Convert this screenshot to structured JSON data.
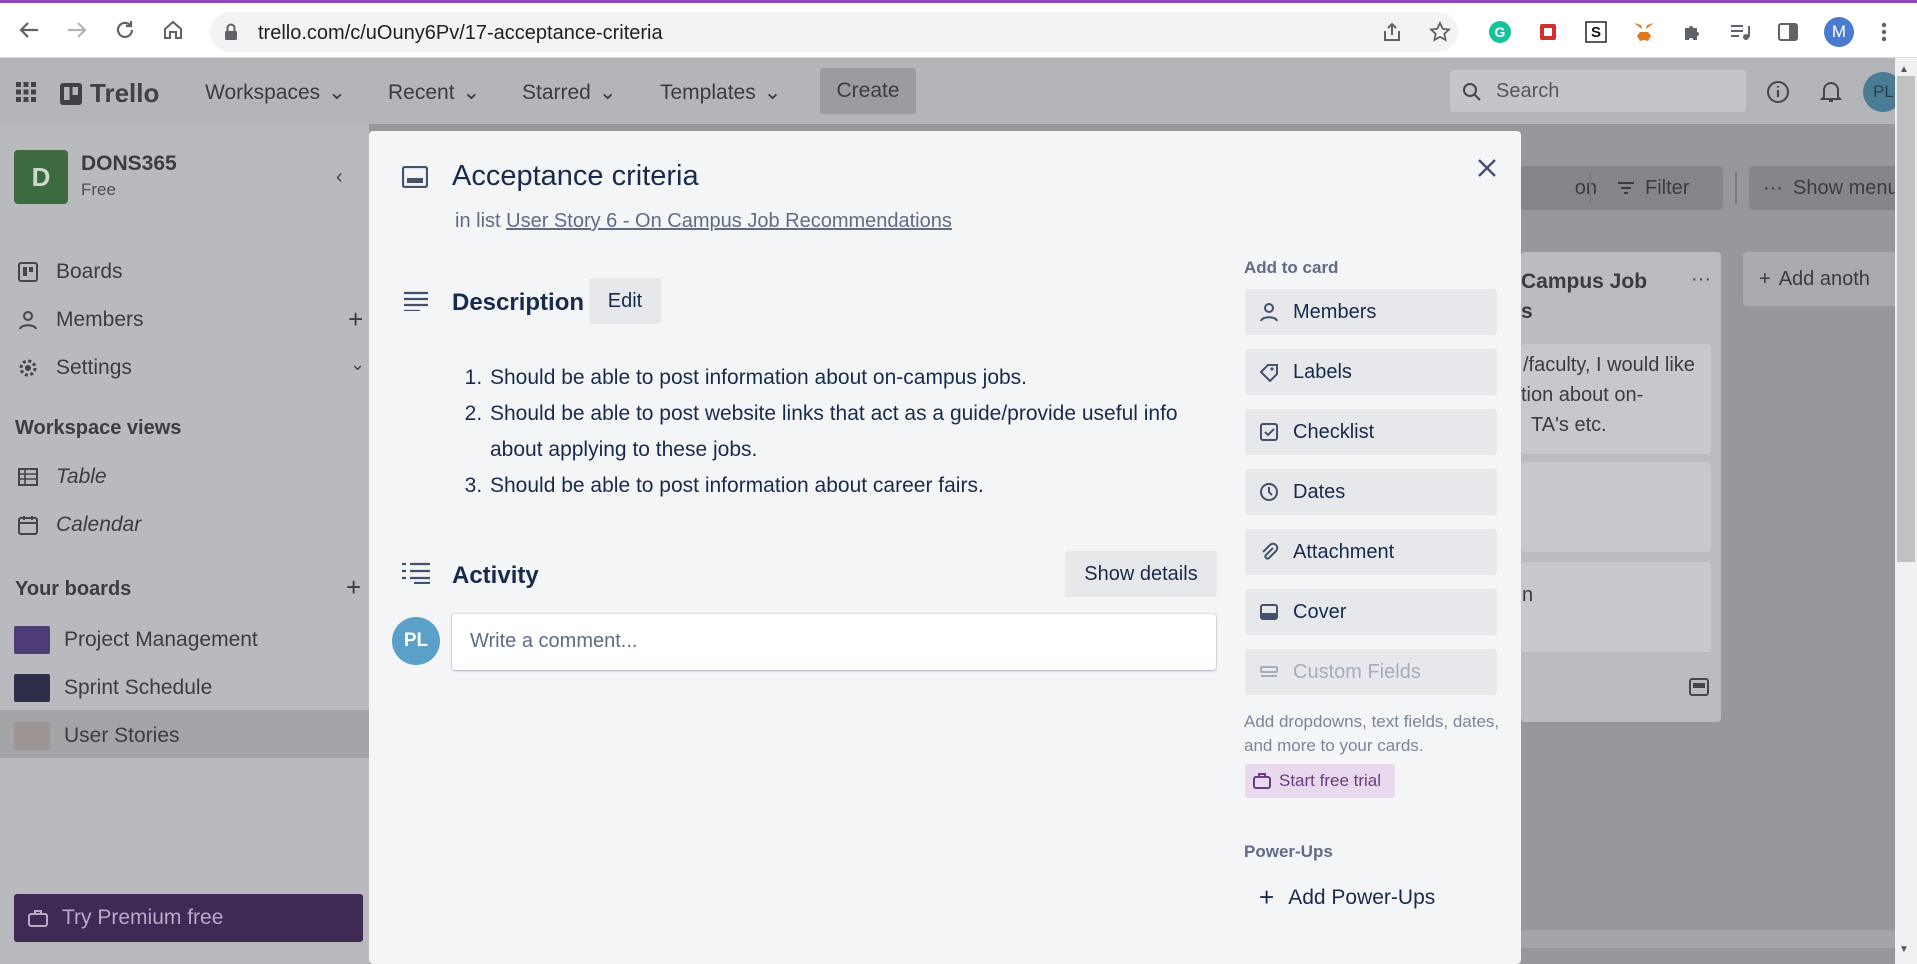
{
  "browser": {
    "url": "trello.com/c/uOuny6Pv/17-acceptance-criteria",
    "profile_initial": "M"
  },
  "trello": {
    "logo": "Trello",
    "menu": [
      "Workspaces",
      "Recent",
      "Starred",
      "Templates"
    ],
    "create": "Create",
    "search_placeholder": "Search",
    "account_initials": "PL"
  },
  "sidebar": {
    "workspace_initial": "D",
    "workspace_name": "DONS365",
    "workspace_plan": "Free",
    "items": [
      "Boards",
      "Members",
      "Settings"
    ],
    "views_header": "Workspace views",
    "views": [
      "Table",
      "Calendar"
    ],
    "your_boards": "Your boards",
    "boards": [
      "Project Management",
      "Sprint Schedule",
      "User Stories"
    ],
    "premium": "Try Premium free"
  },
  "board_bg": {
    "btn_partial": "on",
    "filter": "Filter",
    "show_menu": "Show menu",
    "list_title": "Campus Job",
    "list_title2": "s",
    "add_another": "Add anoth",
    "card_text": [
      "/faculty, I would like",
      "tion about on-",
      "TA's etc."
    ],
    "card2": "n"
  },
  "card": {
    "title": "Acceptance criteria",
    "in_list_prefix": "in list",
    "list_name": "User Story 6 - On Campus Job Recommendations",
    "description_label": "Description",
    "edit": "Edit",
    "description_items": [
      "Should be able to post information about on-campus jobs.",
      "Should be able to post website links that act as a guide/provide useful info about applying to these jobs.",
      "Should be able to post information about career fairs."
    ],
    "activity_label": "Activity",
    "show_details": "Show details",
    "comment_placeholder": "Write a comment...",
    "commenter_initials": "PL"
  },
  "add_to_card": {
    "header": "Add to card",
    "buttons": [
      "Members",
      "Labels",
      "Checklist",
      "Dates",
      "Attachment",
      "Cover",
      "Custom Fields"
    ],
    "custom_fields_hint": "Add dropdowns, text fields, dates, and more to your cards.",
    "trial": "Start free trial",
    "powerups_header": "Power-Ups",
    "add_powerups": "Add Power-Ups"
  },
  "colors": {
    "accent": "#0079bf",
    "trial_purple": "#6b3c86",
    "premium_purple": "#5a2b7a"
  }
}
